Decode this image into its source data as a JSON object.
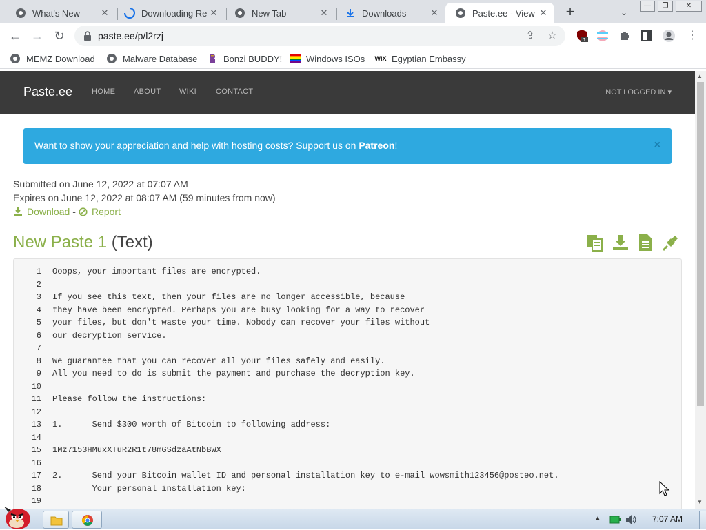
{
  "browser": {
    "tabs": [
      {
        "label": "What's New",
        "icon": "chrome-icon",
        "active": false
      },
      {
        "label": "Downloading Re",
        "icon": "loading-spinner-icon",
        "active": false
      },
      {
        "label": "New Tab",
        "icon": "chrome-icon",
        "active": false
      },
      {
        "label": "Downloads",
        "icon": "download-icon",
        "active": false
      },
      {
        "label": "Paste.ee - View p",
        "icon": "globe-icon",
        "active": true
      }
    ],
    "new_tab": "+",
    "url": "paste.ee/p/l2rzj",
    "ext_badge": "1"
  },
  "bookmarks": [
    {
      "label": "MEMZ Download",
      "icon": "globe-icon"
    },
    {
      "label": "Malware Database",
      "icon": "globe-icon"
    },
    {
      "label": "Bonzi BUDDY!",
      "icon": "bonzi-icon"
    },
    {
      "label": "Windows ISOs",
      "icon": "rainbow-flag-icon"
    },
    {
      "label": "Egyptian Embassy",
      "icon": "wix-icon"
    }
  ],
  "site": {
    "brand": "Paste.ee",
    "nav": [
      "HOME",
      "ABOUT",
      "WIKI",
      "CONTACT"
    ],
    "login": "NOT LOGGED IN",
    "alert": {
      "text": "Want to show your appreciation and help with hosting costs? Support us on ",
      "link": "Patreon",
      "suffix": "!",
      "close": "×"
    },
    "submitted": "Submitted on June 12, 2022 at 07:07 AM",
    "expires": "Expires on June 12, 2022 at 08:07 AM (59 minutes from now)",
    "download": "Download",
    "separator": "-",
    "report": "Report",
    "paste_name": "New Paste 1",
    "paste_type": "(Text)"
  },
  "code_lines": [
    "Ooops, your important files are encrypted.",
    "",
    "If you see this text, then your files are no longer accessible, because",
    "they have been encrypted. Perhaps you are busy looking for a way to recover",
    "your files, but don't waste your time. Nobody can recover your files without",
    "our decryption service.",
    "",
    "We guarantee that you can recover all your files safely and easily.",
    "All you need to do is submit the payment and purchase the decryption key.",
    "",
    "Please follow the instructions:",
    "",
    "1.      Send $300 worth of Bitcoin to following address:",
    "",
    "1Mz7153HMuxXTuR2R1t78mGSdzaAtNbBWX",
    "",
    "2.      Send your Bitcoin wallet ID and personal installation key to e-mail wowsmith123456@posteo.net.",
    "        Your personal installation key:",
    ""
  ],
  "taskbar": {
    "clock": "7:07 AM"
  },
  "colors": {
    "accent_green": "#8bb04a",
    "alert_blue": "#2ea9e0",
    "navbar": "#3a3a3a"
  }
}
